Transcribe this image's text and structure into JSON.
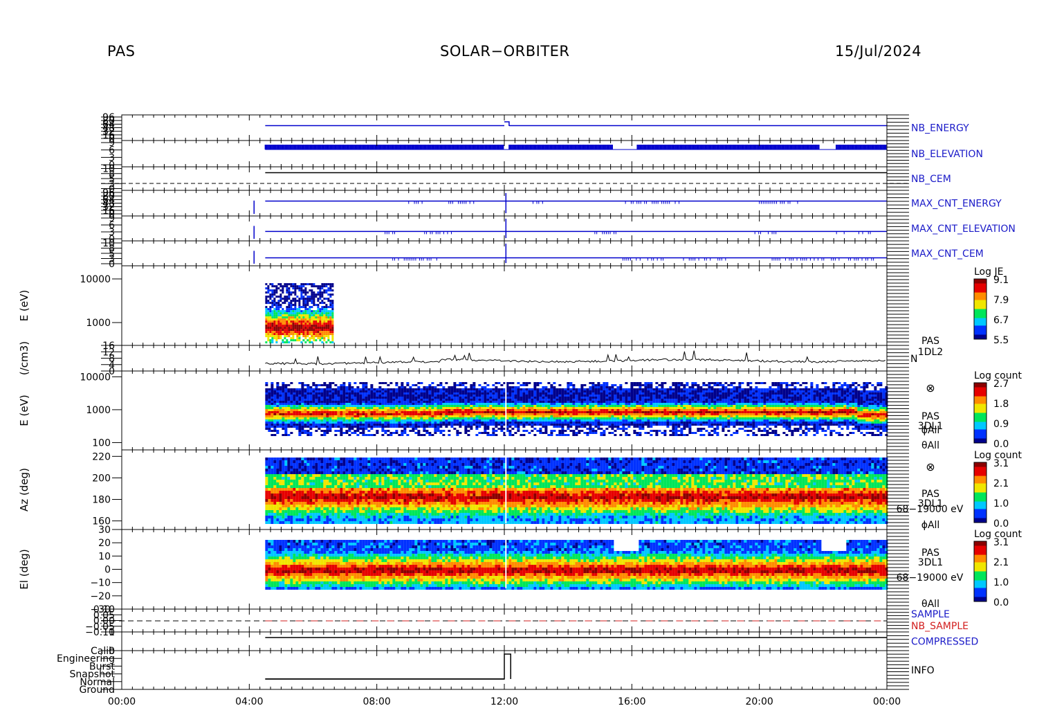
{
  "header": {
    "left": "PAS",
    "center": "SOLAR−ORBITER",
    "right": "15/Jul/2024"
  },
  "colors": {
    "axis": "#000000",
    "label_blue": "#1a1ac8",
    "label_red": "#d21e1e",
    "trace_blue": "#0000cc",
    "trace_black": "#000000",
    "spec_dark": "#00008b",
    "spec_blue": "#0032ff",
    "spec_cyan": "#00c8ff",
    "spec_green": "#00e65a",
    "spec_yellow": "#f0e600",
    "spec_orange": "#ff8c00",
    "spec_red": "#e60000",
    "spec_darkred": "#8b0000"
  },
  "chart_data": [
    {
      "type": "line",
      "name": "NB_ENERGY",
      "right_label": "NB_ENERGY",
      "label_color": "blue",
      "ticks": [
        "96",
        "80",
        "64",
        "48",
        "32",
        "16",
        "0"
      ]
    },
    {
      "type": "line",
      "name": "NB_ELEVATION",
      "right_label": "NB_ELEVATION",
      "label_color": "blue",
      "ticks": [
        "9",
        "6",
        "3",
        "0"
      ]
    },
    {
      "type": "line",
      "name": "NB_CEM",
      "right_label": "NB_CEM",
      "label_color": "blue",
      "ticks": [
        "10",
        "8",
        "5",
        "3",
        "0"
      ]
    },
    {
      "type": "line",
      "name": "MAX_CNT_ENERGY",
      "right_label": "MAX_CNT_ENERGY",
      "label_color": "blue",
      "ticks": [
        "96",
        "80",
        "64",
        "48",
        "32",
        "16",
        "0"
      ]
    },
    {
      "type": "line",
      "name": "MAX_CNT_ELEVATION",
      "right_label": "MAX_CNT_ELEVATION",
      "label_color": "blue",
      "ticks": [
        "9",
        "6",
        "3",
        "0"
      ]
    },
    {
      "type": "line",
      "name": "MAX_CNT_CEM",
      "right_label": "MAX_CNT_CEM",
      "label_color": "blue",
      "ticks": [
        "10",
        "8",
        "5",
        "3",
        "0"
      ]
    },
    {
      "type": "heatmap",
      "ylabel": "E (eV)",
      "yscale": "log",
      "ylim": [
        300,
        20000
      ],
      "ticks": [
        "10000",
        "1000"
      ],
      "colorbar": {
        "title": "Log JE",
        "ticks": [
          "9.1",
          "7.9",
          "6.7",
          "5.5"
        ],
        "range": [
          5.5,
          9.1
        ]
      },
      "data_extent_hours": [
        4.5,
        6.6
      ],
      "peak_energy_ev": 800
    },
    {
      "type": "line",
      "ylabel": "(/cm3)",
      "ticks": [
        "16",
        "12",
        "8",
        "4",
        "0"
      ],
      "right_label": [
        "PAS",
        "1DL2",
        "N"
      ]
    },
    {
      "type": "heatmap",
      "ylabel": "E (eV)",
      "yscale": "log",
      "ylim": [
        60,
        15000
      ],
      "ticks": [
        "10000",
        "1000",
        "100"
      ],
      "colorbar": {
        "title": "Log count",
        "ticks": [
          "2.7",
          "1.8",
          "0.9",
          "0.0"
        ],
        "range": [
          0.0,
          2.7
        ]
      },
      "right_label": [
        "PAS",
        "3DL1",
        "ϕAll",
        "θAll"
      ],
      "data_extent_hours": [
        4.5,
        24.0
      ],
      "peak_energy_ev": 850
    },
    {
      "type": "heatmap",
      "ylabel": "Az (deg)",
      "ylim": [
        152,
        226
      ],
      "ticks": [
        "220",
        "200",
        "180",
        "160"
      ],
      "colorbar": {
        "title": "Log count",
        "ticks": [
          "3.1",
          "2.1",
          "1.0",
          "0.0"
        ],
        "range": [
          0.0,
          3.1
        ]
      },
      "right_label": [
        "PAS",
        "3DL1",
        "68−19000 eV",
        "ϕAll"
      ],
      "data_extent_hours": [
        4.5,
        24.0
      ],
      "peak_angle_deg": 180
    },
    {
      "type": "heatmap",
      "ylabel": "El (deg)",
      "ylim": [
        -30,
        30
      ],
      "ticks": [
        "30",
        "20",
        "10",
        "0",
        "−10",
        "−20",
        "−30"
      ],
      "colorbar": {
        "title": "Log count",
        "ticks": [
          "3.1",
          "2.1",
          "1.0",
          "0.0"
        ],
        "range": [
          0.0,
          3.1
        ]
      },
      "right_label": [
        "PAS",
        "3DL1",
        "68−19000 eV",
        "θAll"
      ],
      "data_extent_hours": [
        4.5,
        24.0
      ],
      "peak_angle_deg": 0
    },
    {
      "type": "line",
      "name": "SAMPLE",
      "ticks": [
        "0.10",
        "0.05",
        "0.00",
        "−0.05",
        "−0.10"
      ],
      "right_label": [
        "SAMPLE",
        "NB_SAMPLE"
      ]
    },
    {
      "type": "line",
      "name": "COMPRESSED",
      "ticks": [
        "1",
        "0"
      ],
      "right_label": "COMPRESSED"
    },
    {
      "type": "line",
      "name": "INFO",
      "ticks": [
        "Calib",
        "Engineering",
        "Burst",
        "Snapshot",
        "Normal",
        "Ground"
      ],
      "right_label": "INFO"
    }
  ],
  "time_axis": {
    "labels": [
      "00:00",
      "04:00",
      "08:00",
      "12:00",
      "16:00",
      "20:00",
      "00:00"
    ],
    "hours": [
      0,
      4,
      8,
      12,
      16,
      20,
      24
    ]
  }
}
